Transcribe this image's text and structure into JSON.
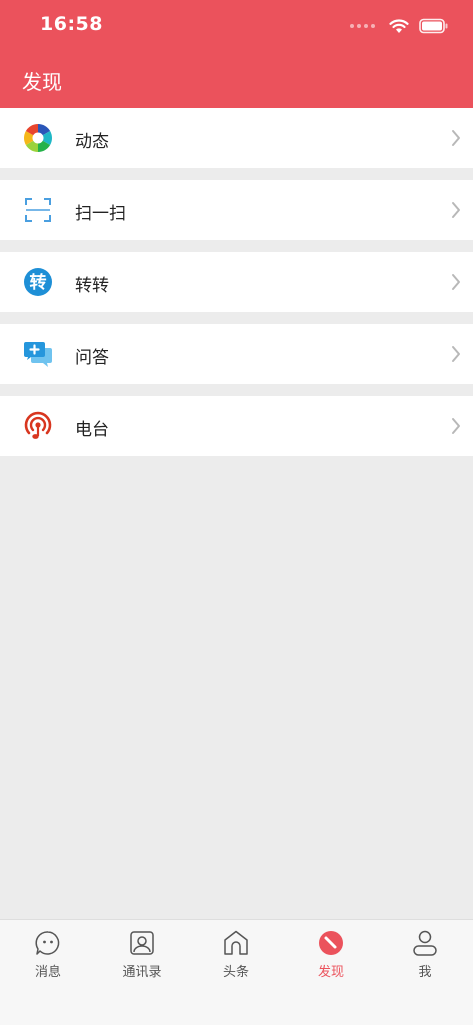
{
  "status_bar": {
    "time": "16:58"
  },
  "nav": {
    "title": "发现"
  },
  "colors": {
    "accent": "#eb525c",
    "background": "#ececec",
    "inactive_tab": "#555555"
  },
  "items": [
    {
      "label": "动态",
      "icon": "camera-shutter-icon"
    },
    {
      "label": "扫一扫",
      "icon": "scan-icon"
    },
    {
      "label": "转转",
      "icon": "zhuanzhuan-icon"
    },
    {
      "label": "问答",
      "icon": "qa-chat-icon"
    },
    {
      "label": "电台",
      "icon": "radio-icon"
    }
  ],
  "tabbar": {
    "tabs": [
      {
        "label": "消息",
        "icon": "message-icon",
        "active": false
      },
      {
        "label": "通讯录",
        "icon": "contacts-icon",
        "active": false
      },
      {
        "label": "头条",
        "icon": "headlines-icon",
        "active": false
      },
      {
        "label": "发现",
        "icon": "discover-icon",
        "active": true
      },
      {
        "label": "我",
        "icon": "profile-icon",
        "active": false
      }
    ]
  }
}
